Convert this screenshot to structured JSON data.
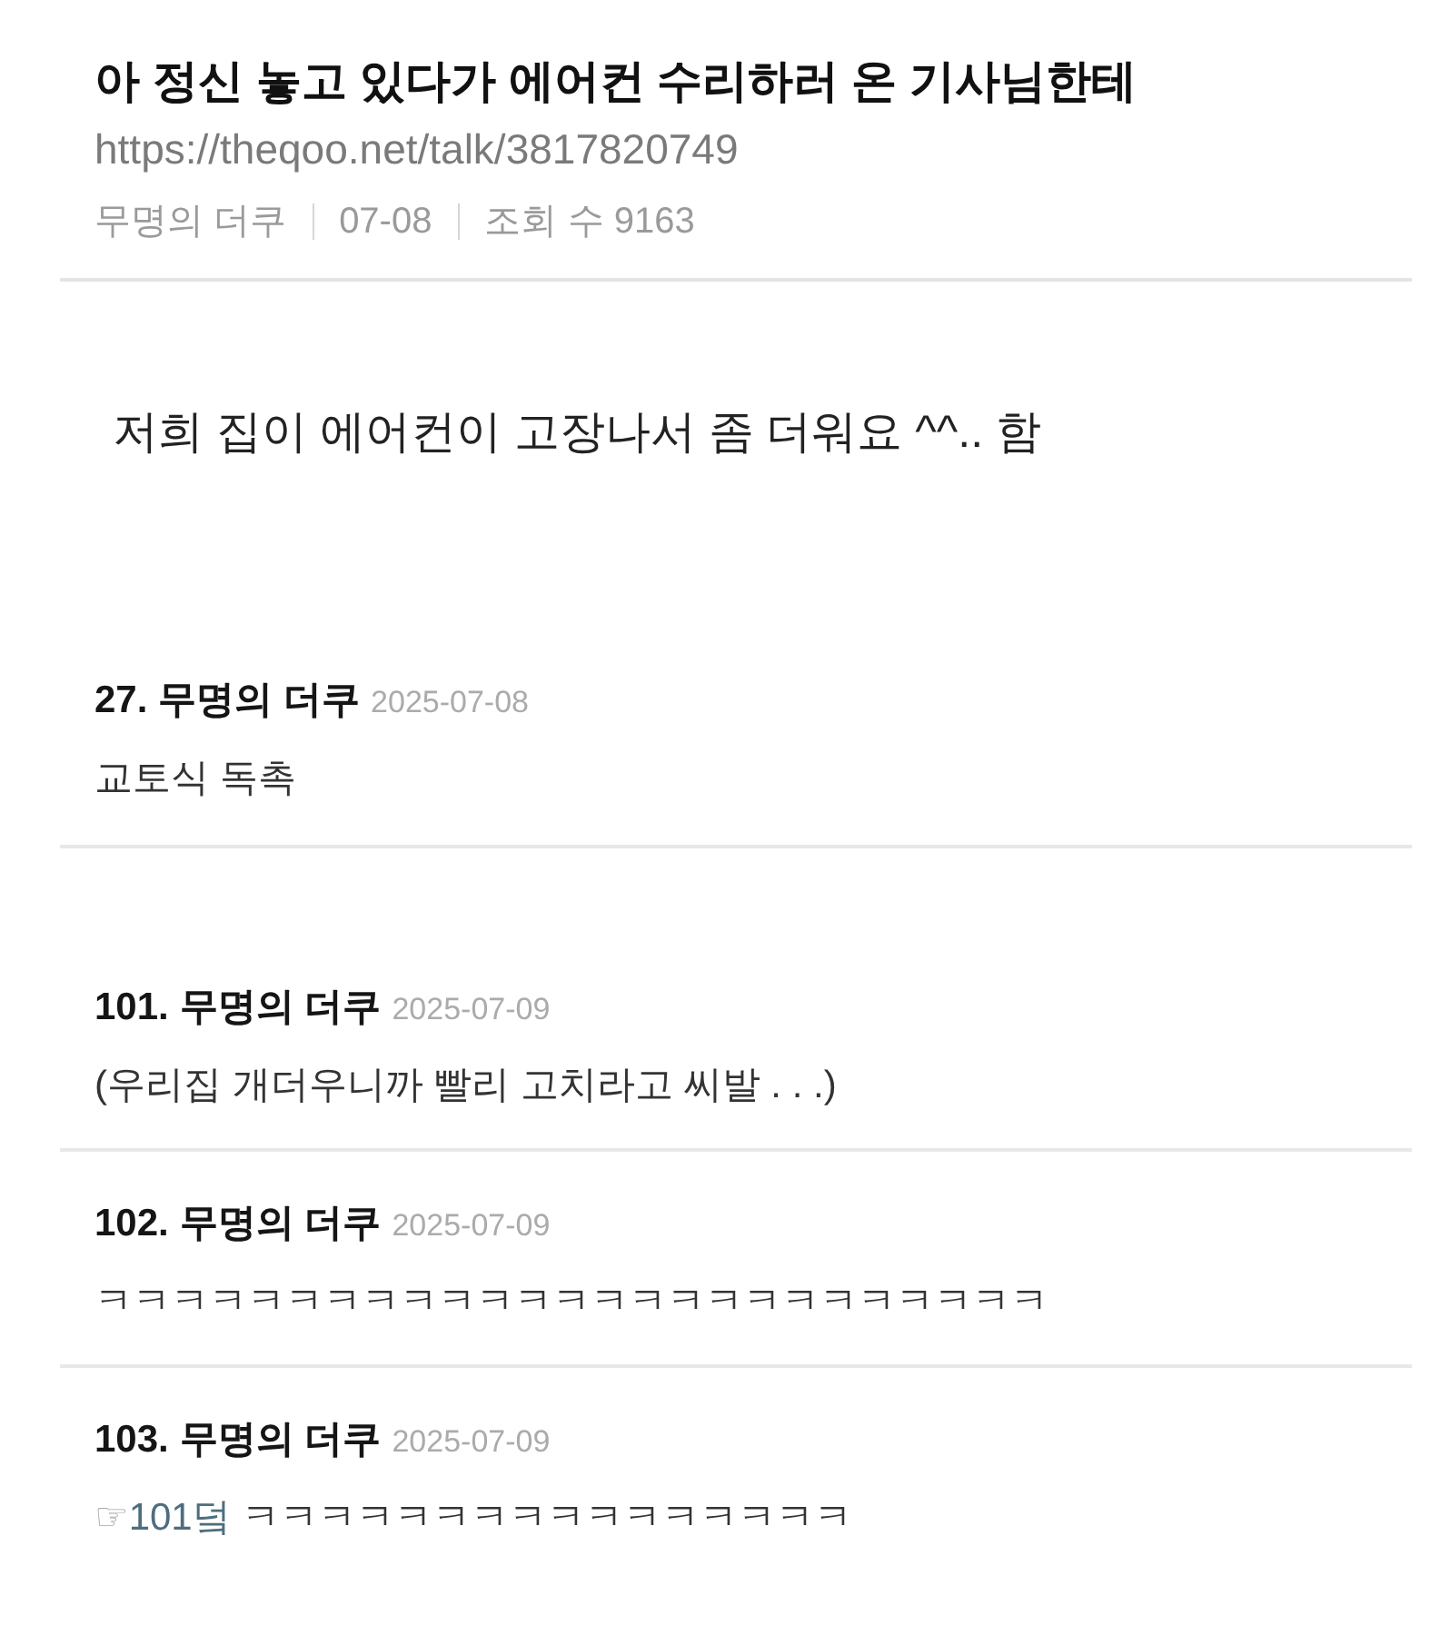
{
  "post": {
    "title": "아 정신 놓고 있다가 에어컨 수리하러 온 기사님한테",
    "url": "https://theqoo.net/talk/3817820749",
    "meta": [
      "무명의 더쿠",
      "07-08",
      "조회 수 9163"
    ],
    "body": "저희 집이 에어컨이 고장나서 좀 더워요 ^^.. 함"
  },
  "comments": [
    {
      "number": "27.",
      "author": "무명의 더쿠",
      "date": "2025-07-08",
      "text": "교토식 독촉"
    },
    {
      "number": "101.",
      "author": "무명의 더쿠",
      "date": "2025-07-09",
      "text": "(우리집 개더우니까 빨리 고치라고 씨발 . . .)"
    },
    {
      "number": "102.",
      "author": "무명의 더쿠",
      "date": "2025-07-09",
      "text": "ㅋㅋㅋㅋㅋㅋㅋㅋㅋㅋㅋㅋㅋㅋㅋㅋㅋㅋㅋㅋㅋㅋㅋㅋㅋ"
    },
    {
      "number": "103.",
      "author": "무명의 더쿠",
      "date": "2025-07-09",
      "reply_to": {
        "pointer": "☞",
        "label": "101덬"
      },
      "text": "ㅋㅋㅋㅋㅋㅋㅋㅋㅋㅋㅋㅋㅋㅋㅋㅋ"
    }
  ]
}
